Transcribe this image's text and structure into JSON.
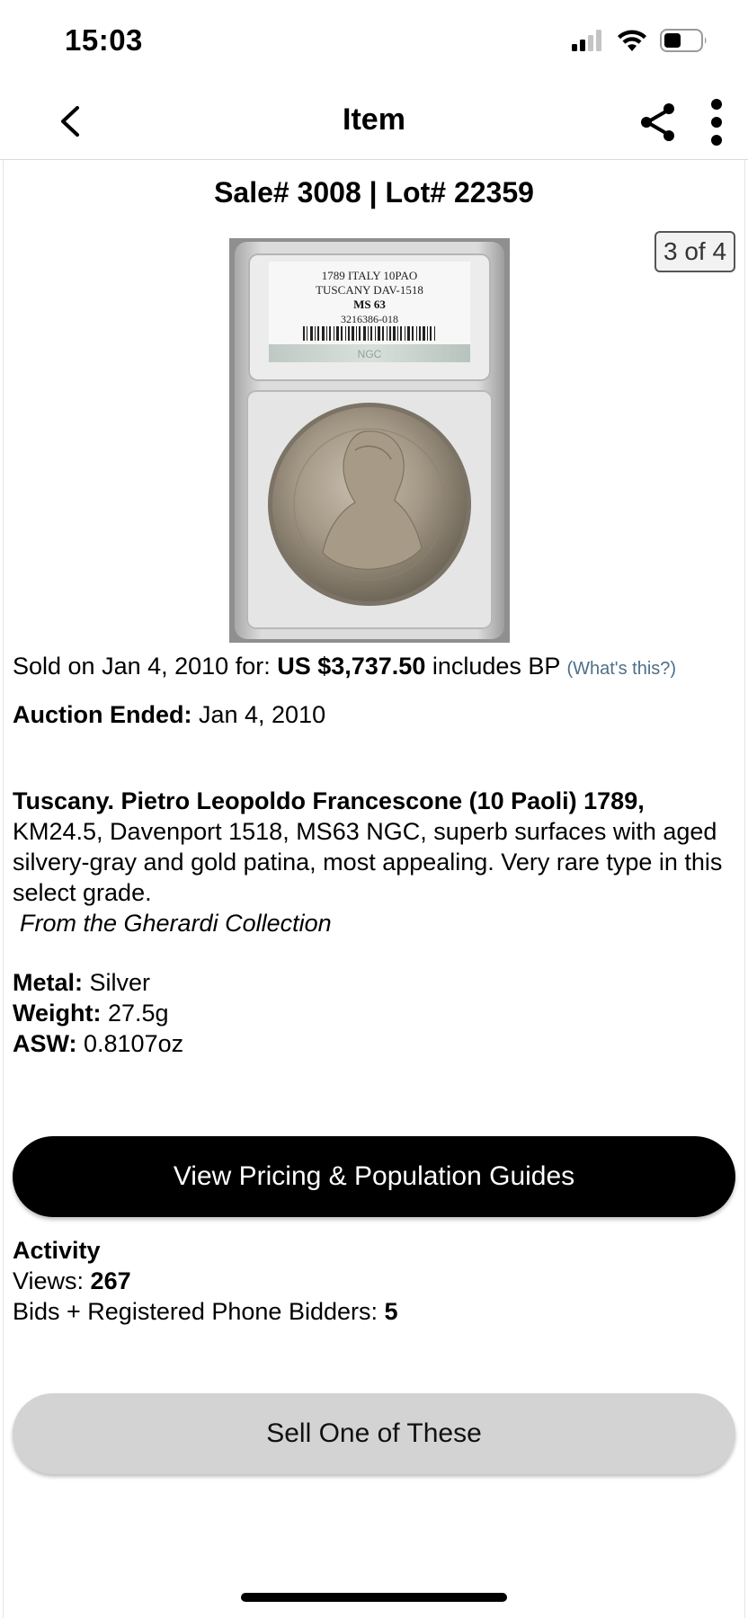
{
  "status_bar": {
    "time": "15:03"
  },
  "nav": {
    "title": "Item"
  },
  "item": {
    "sale_title": "Sale# 3008 | Lot# 22359",
    "image_counter": "3 of 4",
    "slab_label": {
      "line1": "1789 ITALY 10PAO",
      "line2": "TUSCANY DAV-1518",
      "grade": "MS 63",
      "cert": "3216386-018",
      "grader": "NGC"
    },
    "sold_prefix": "Sold on Jan 4, 2010 for: ",
    "sold_price": "US $3,737.50",
    "sold_suffix": " includes BP ",
    "whats_this": "(What's this?)",
    "auction_ended_label": "Auction Ended:",
    "auction_ended_value": " Jan 4, 2010",
    "description_lead": "Tuscany. Pietro Leopoldo Francescone (10 Paoli) 1789,",
    "description_body": "KM24.5, Davenport 1518, MS63 NGC, superb surfaces with aged silvery-gray and gold patina, most appealing. Very rare type in this select grade.",
    "provenance": "From the Gherardi Collection",
    "specs": [
      {
        "label": "Metal:",
        "value": " Silver"
      },
      {
        "label": "Weight:",
        "value": " 27.5g"
      },
      {
        "label": "ASW:",
        "value": " 0.8107oz"
      }
    ]
  },
  "buttons": {
    "pricing": "View Pricing & Population Guides",
    "sell": "Sell One of These"
  },
  "activity": {
    "heading": "Activity",
    "views_label": "Views: ",
    "views_value": "267",
    "bids_label": "Bids + Registered Phone Bidders: ",
    "bids_value": "5"
  },
  "colors": {
    "link": "#4d6f8a",
    "primary_button": "#000000",
    "secondary_button": "#d3d3d3"
  }
}
